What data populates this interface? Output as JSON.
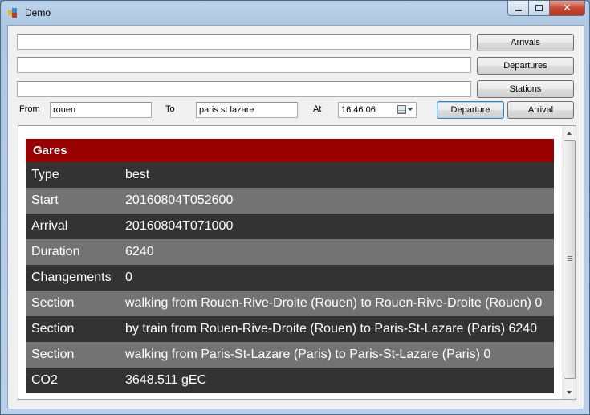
{
  "window": {
    "title": "Demo",
    "controls": {
      "minimize": "",
      "maximize": "",
      "close": "✕"
    }
  },
  "query": {
    "arrivals_input": "",
    "departures_input": "",
    "stations_input": "",
    "arrivals_button": "Arrivals",
    "departures_button": "Departures",
    "stations_button": "Stations",
    "from_label": "From",
    "from_value": "rouen",
    "to_label": "To",
    "to_value": "paris st lazare",
    "at_label": "At",
    "time_value": "16:46:06",
    "departure_button": "Departure",
    "arrival_button": "Arrival"
  },
  "result": {
    "header": "Gares",
    "rows": [
      {
        "key": "Type",
        "value": "best"
      },
      {
        "key": "Start",
        "value": "20160804T052600"
      },
      {
        "key": "Arrival",
        "value": "20160804T071000"
      },
      {
        "key": "Duration",
        "value": "6240"
      },
      {
        "key": "Changements",
        "value": "0"
      },
      {
        "key": "Section",
        "value": "walking from Rouen-Rive-Droite (Rouen) to Rouen-Rive-Droite (Rouen) 0"
      },
      {
        "key": "Section",
        "value": "by train from Rouen-Rive-Droite (Rouen) to Paris-St-Lazare (Paris) 6240"
      },
      {
        "key": "Section",
        "value": "walking from Paris-St-Lazare (Paris) to Paris-St-Lazare (Paris) 0"
      },
      {
        "key": "CO2",
        "value": "3648.511 gEC"
      }
    ]
  },
  "colors": {
    "header_bg": "#990000",
    "row_dark": "#333333",
    "row_light": "#737373",
    "window_frame": "#bcd3ea"
  },
  "icons": {
    "app": "app-icon",
    "date_picker": "calendar-icon",
    "dropdown": "chevron-down-icon"
  }
}
